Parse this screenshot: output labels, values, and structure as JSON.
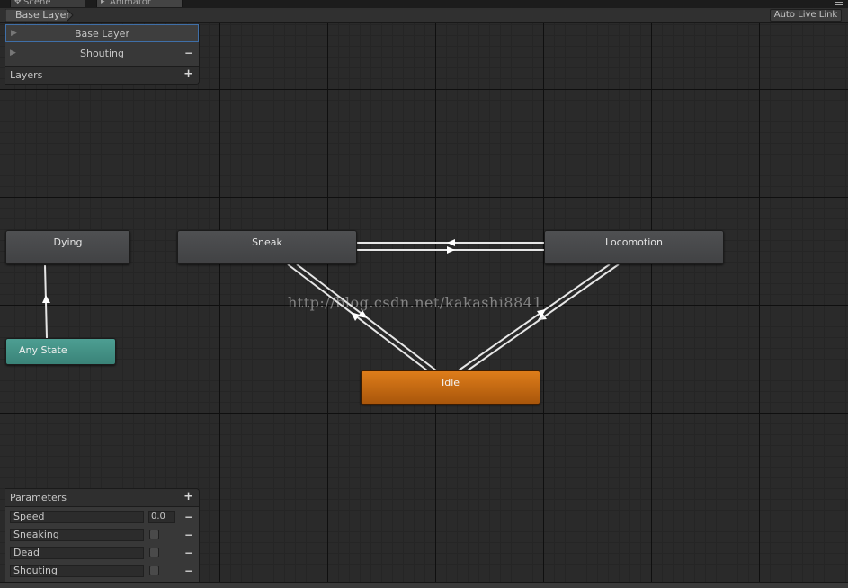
{
  "tabs": [
    {
      "label": "Scene",
      "icon": "scene-icon"
    },
    {
      "label": "Animator",
      "icon": "animator-icon"
    }
  ],
  "toolbar": {
    "breadcrumb": "Base Layer",
    "auto_live_link": "Auto Live Link"
  },
  "layers": {
    "items": [
      {
        "name": "Base Layer",
        "selected": true
      },
      {
        "name": "Shouting",
        "selected": false
      }
    ],
    "header": "Layers",
    "add_symbol": "+",
    "remove_symbol": "−"
  },
  "states": {
    "dying": "Dying",
    "sneak": "Sneak",
    "locomotion": "Locomotion",
    "any_state": "Any State",
    "idle": "Idle"
  },
  "colors": {
    "default_state": "#46474a",
    "any_state": "#449186",
    "entry_default_state": "#c86c12",
    "selection_outline": "#3f6fa8",
    "transition": "#e6e6e6"
  },
  "transitions": [
    {
      "from": "Any State",
      "to": "Dying"
    },
    {
      "from": "Sneak",
      "to": "Locomotion"
    },
    {
      "from": "Locomotion",
      "to": "Sneak"
    },
    {
      "from": "Sneak",
      "to": "Idle"
    },
    {
      "from": "Idle",
      "to": "Sneak"
    },
    {
      "from": "Locomotion",
      "to": "Idle"
    },
    {
      "from": "Idle",
      "to": "Locomotion"
    }
  ],
  "parameters": {
    "header": "Parameters",
    "add_symbol": "+",
    "remove_symbol": "−",
    "items": [
      {
        "name": "Speed",
        "type": "float",
        "value": "0.0"
      },
      {
        "name": "Sneaking",
        "type": "bool",
        "checked": false
      },
      {
        "name": "Dead",
        "type": "bool",
        "checked": false
      },
      {
        "name": "Shouting",
        "type": "bool",
        "checked": false
      }
    ]
  },
  "watermark": "http://blog.csdn.net/kakashi8841"
}
